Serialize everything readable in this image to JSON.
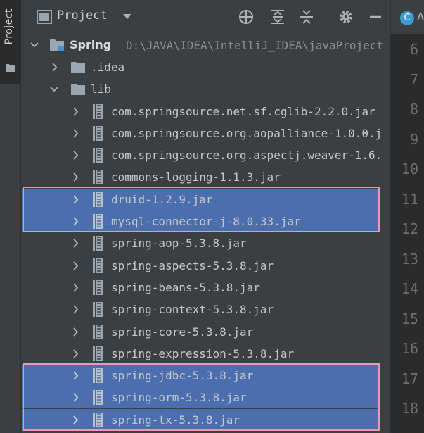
{
  "sidebar": {
    "tab_label": "Project"
  },
  "header": {
    "title": "Project",
    "buttons": [
      "locate-icon",
      "expand-all-icon",
      "collapse-all-icon",
      "gear-icon",
      "hide-icon"
    ]
  },
  "tree": {
    "root": {
      "name": "Spring",
      "path": "D:\\JAVA\\IDEA\\IntelliJ_IDEA\\javaProject"
    },
    "folders": [
      {
        "name": ".idea",
        "expanded": false
      },
      {
        "name": "lib",
        "expanded": true
      }
    ],
    "jars": [
      {
        "name": "com.springsource.net.sf.cglib-2.2.0.jar",
        "selected": false
      },
      {
        "name": "com.springsource.org.aopalliance-1.0.0.j",
        "selected": false
      },
      {
        "name": "com.springsource.org.aspectj.weaver-1.6.",
        "selected": false
      },
      {
        "name": "commons-logging-1.1.3.jar",
        "selected": false
      },
      {
        "name": "druid-1.2.9.jar",
        "selected": true
      },
      {
        "name": "mysql-connector-j-8.0.33.jar",
        "selected": true
      },
      {
        "name": "spring-aop-5.3.8.jar",
        "selected": false
      },
      {
        "name": "spring-aspects-5.3.8.jar",
        "selected": false
      },
      {
        "name": "spring-beans-5.3.8.jar",
        "selected": false
      },
      {
        "name": "spring-context-5.3.8.jar",
        "selected": false
      },
      {
        "name": "spring-core-5.3.8.jar",
        "selected": false
      },
      {
        "name": "spring-expression-5.3.8.jar",
        "selected": false
      },
      {
        "name": "spring-jdbc-5.3.8.jar",
        "selected": true
      },
      {
        "name": "spring-orm-5.3.8.jar",
        "selected": true
      },
      {
        "name": "spring-tx-5.3.8.jar",
        "selected": true
      }
    ]
  },
  "editor": {
    "tab_icon_letter": "C",
    "tab_label": "A",
    "line_numbers": [
      "6",
      "7",
      "8",
      "9",
      "10",
      "11",
      "12",
      "13",
      "14",
      "15",
      "16",
      "17",
      "18"
    ]
  },
  "colors": {
    "selection": "#4b6eaf",
    "highlight_border": "#e89ab0",
    "panel_bg": "#3c3f41",
    "editor_bg": "#2b2b2b"
  }
}
